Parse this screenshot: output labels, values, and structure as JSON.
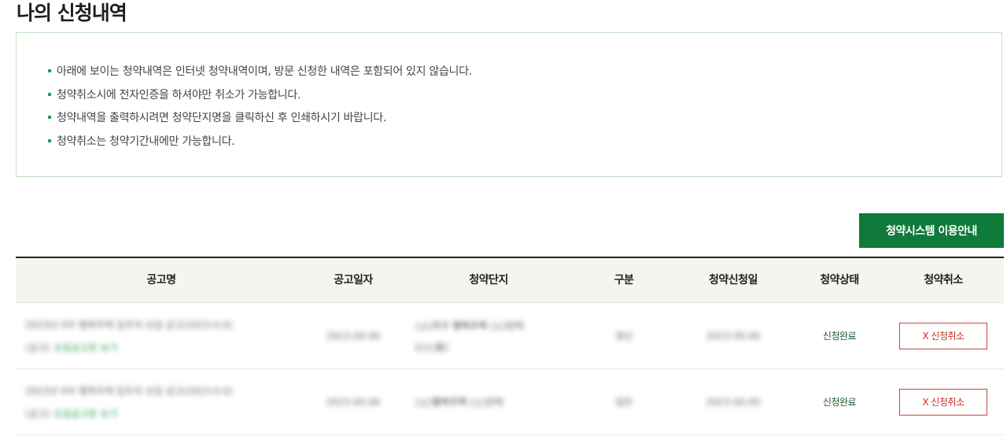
{
  "page": {
    "title": "나의 신청내역"
  },
  "notice": {
    "items": [
      "아래에 보이는 청약내역은 인터넷 청약내역이며, 방문 신청한 내역은 포함되어 있지 않습니다.",
      "청약취소시에 전자인증을 하셔야만 취소가 가능합니다.",
      "청약내역을 출력하시려면 청약단지명을 클릭하신 후 인쇄하시기 바랍니다.",
      "청약취소는 청약기간내에만 가능합니다."
    ],
    "bullet_color": "#2e9e4f"
  },
  "guide_button": {
    "label": "청약시스템 이용안내",
    "color": "#0f7a3a"
  },
  "table": {
    "headers": [
      "공고명",
      "공고일자",
      "청약단지",
      "구분",
      "청약신청일",
      "청약상태",
      "청약취소"
    ],
    "rows": [
      {
        "notice_line1": "2023년 0차 행복주택 입주자 모집 공고(2023.0.0)",
        "notice_line2": "(공고)",
        "notice_link": "모집공고문 보기",
        "date": "2023.00.00",
        "complex_line1": "○○지구 행복주택 ○○단지",
        "complex_line2": "(○○동)",
        "type": "청년",
        "apply_date": "2023.00.00",
        "status": "신청완료",
        "cancel_label": "X 신청취소"
      },
      {
        "notice_line1": "2023년 0차 행복주택 입주자 모집 공고(2023.0.0)",
        "notice_line2": "(공고)",
        "notice_link": "모집공고문 보기",
        "date": "2023.00.00",
        "complex_line1": "○○행복주택 ○○단지",
        "complex_line2": "",
        "type": "일반",
        "apply_date": "2023.00.00",
        "status": "신청완료",
        "cancel_label": "X 신청취소"
      }
    ]
  }
}
